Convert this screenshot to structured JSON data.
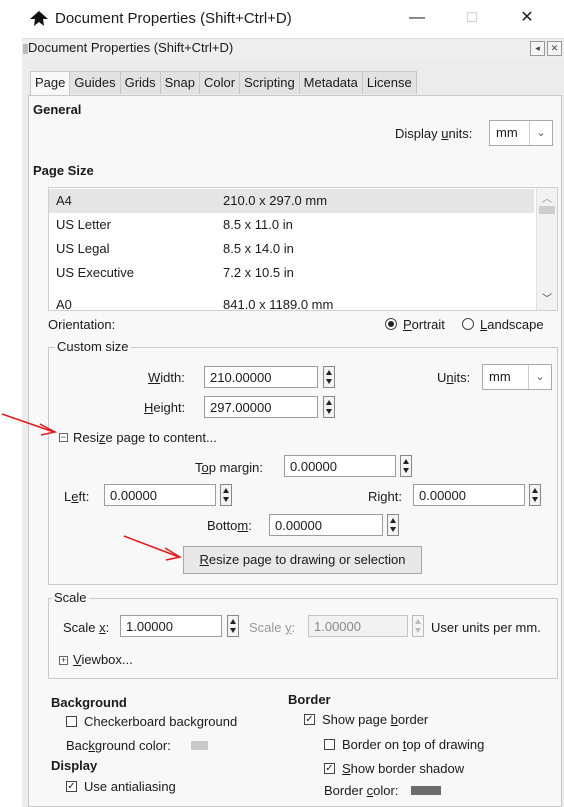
{
  "window": {
    "title": "Document Properties (Shift+Ctrl+D)",
    "minimize_glyph": "—",
    "maximize_glyph": "□",
    "close_glyph": "✕"
  },
  "dock": {
    "title": "Document Properties (Shift+Ctrl+D)"
  },
  "tabs": [
    "Page",
    "Guides",
    "Grids",
    "Snap",
    "Color",
    "Scripting",
    "Metadata",
    "License"
  ],
  "general": {
    "heading": "General",
    "display_units_label": "Display units:",
    "display_units_value": "mm"
  },
  "page_size": {
    "heading": "Page Size",
    "rows": [
      {
        "name": "A4",
        "size": "210.0 x 297.0 mm"
      },
      {
        "name": "US Letter",
        "size": "8.5 x 11.0 in"
      },
      {
        "name": "US Legal",
        "size": "8.5 x 14.0 in"
      },
      {
        "name": "US Executive",
        "size": "7.2 x 10.5 in"
      },
      {
        "name": "A0",
        "size": "841.0 x 1189.0 mm"
      }
    ],
    "orientation_label": "Orientation:",
    "portrait": "Portrait",
    "landscape": "Landscape"
  },
  "custom_size": {
    "legend": "Custom size",
    "width_label": "Width:",
    "width_value": "210.00000",
    "height_label": "Height:",
    "height_value": "297.00000",
    "units_label": "Units:",
    "units_value": "mm",
    "resize_expander": "Resize page to content...",
    "top_margin_label": "Top margin:",
    "top_margin_value": "0.00000",
    "left_label": "Left:",
    "left_value": "0.00000",
    "right_label": "Right:",
    "right_value": "0.00000",
    "bottom_label": "Bottom:",
    "bottom_value": "0.00000",
    "resize_button": "Resize page to drawing or selection"
  },
  "scale": {
    "legend": "Scale",
    "scale_x_label": "Scale x:",
    "scale_x_value": "1.00000",
    "scale_y_label": "Scale y:",
    "scale_y_value": "1.00000",
    "units_text": "User units per mm.",
    "viewbox": "Viewbox..."
  },
  "background": {
    "heading": "Background",
    "checkerboard": "Checkerboard background",
    "color_label": "Background color:"
  },
  "border": {
    "heading": "Border",
    "show_page_border": "Show page border",
    "border_on_top": "Border on top of drawing",
    "show_border_shadow": "Show border shadow",
    "color_label": "Border color:"
  },
  "display": {
    "heading": "Display",
    "antialiasing": "Use antialiasing"
  },
  "colors": {
    "annotation_arrow": "#e0191b",
    "background_swatch": "#c8c8c8",
    "border_swatch": "#6d6d6d"
  },
  "states": {
    "checkerboard": false,
    "show_page_border": true,
    "border_on_top": false,
    "show_border_shadow": true,
    "antialiasing": true,
    "orientation": "Portrait"
  }
}
